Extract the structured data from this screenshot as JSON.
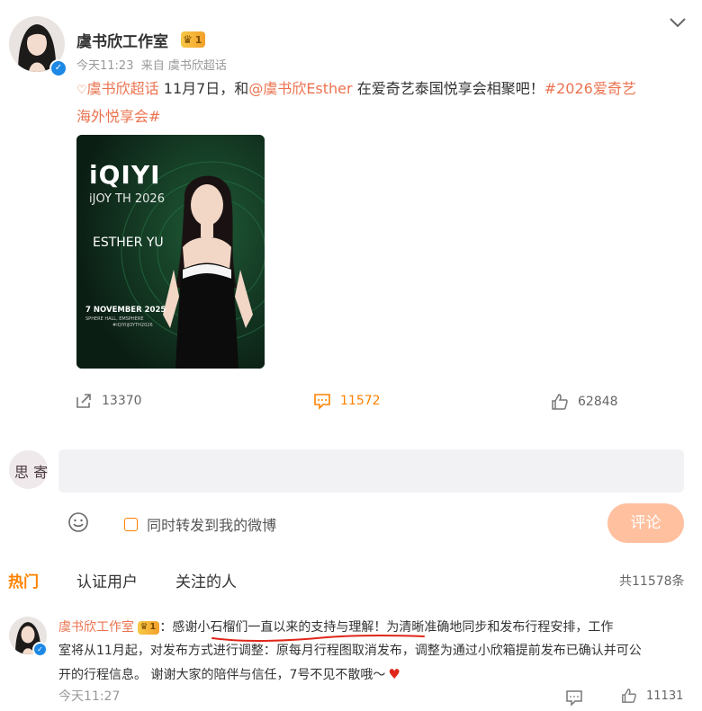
{
  "post": {
    "author": "虞书欣工作室",
    "level": "1",
    "time": "今天11:23",
    "source": "来自 虞书欣超话",
    "text": {
      "tag1": "虞书欣超话",
      "t1": " 11月7日，和",
      "mention": "@虞书欣Esther",
      "t2": " 在爱奇艺泰国悦享会相聚吧！",
      "hashtag_a": "#2026爱奇艺",
      "hashtag_b": "海外悦享会#"
    },
    "image": {
      "brand": "iQIYI",
      "event": "iJOY TH 2026",
      "name": "ESTHER YU",
      "date": "7 NOVEMBER 2025",
      "venue": "SPHERE HALL, EMSPHERE",
      "tag": "#iQIYIiJOYTH2026"
    },
    "actions": {
      "share": "13370",
      "comment": "11572",
      "like": "62848"
    }
  },
  "compose": {
    "placeholder": "",
    "forward_label": "同时转发到我的微博",
    "submit": "评论"
  },
  "tabs": {
    "hot": "热门",
    "verified": "认证用户",
    "following": "关注的人",
    "total": "共11578条"
  },
  "comment": {
    "author": "虞书欣工作室",
    "level": "1",
    "sep": "：",
    "highlight": "感谢小石榴们一直以来的支持与理解",
    "line1_rest": "！为清晰准确地同步和发布行程安排，工作",
    "line2": "室将从11月起，对发布方式进行调整：原每月行程图取消发布，调整为通过小欣箱提前发布已确认并可公",
    "line3": "开的行程信息。 谢谢大家的陪伴与信任，7号不见不散哦～",
    "time": "今天11:27",
    "likes": "11131"
  },
  "colors": {
    "accent": "#ff8200",
    "link": "#eb7350",
    "button": "#ffc09f",
    "verify": "#1e88e5",
    "underline": "#e0261a"
  }
}
